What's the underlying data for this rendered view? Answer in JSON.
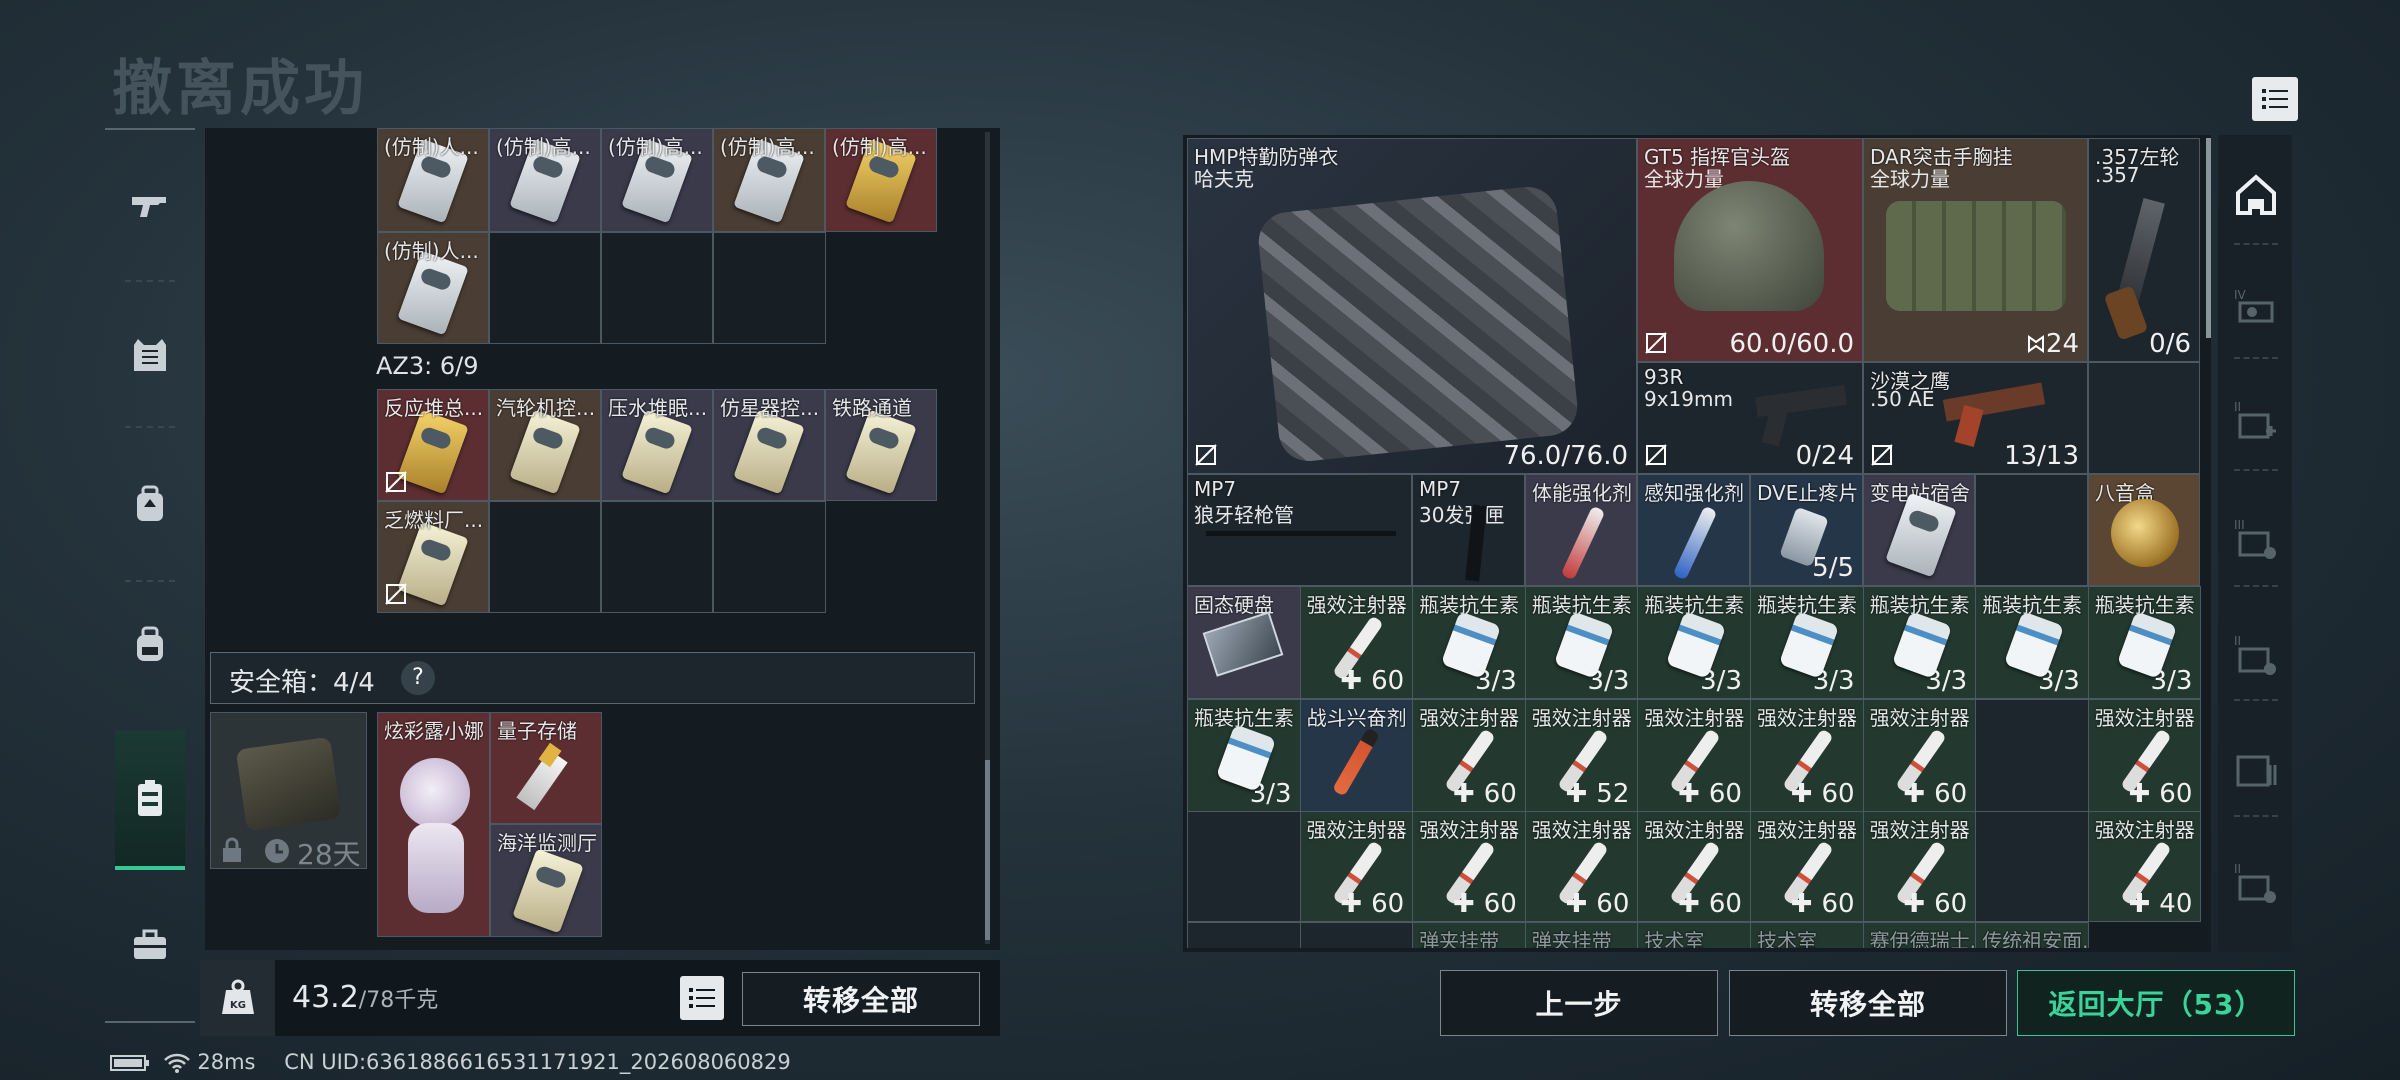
{
  "page": {
    "title": "撤离成功"
  },
  "sidebar": {
    "items": [
      {
        "icon": "pistol-icon"
      },
      {
        "icon": "vest-icon"
      },
      {
        "icon": "backpack-armor-icon"
      },
      {
        "icon": "backpack-icon"
      },
      {
        "icon": "safe-case-icon",
        "active": true
      },
      {
        "icon": "briefcase-icon"
      }
    ]
  },
  "left": {
    "top_row": [
      "(仿制)人...",
      "(仿制)高...",
      "(仿制)高...",
      "(仿制)高...",
      "(仿制)高..."
    ],
    "top_row2": [
      "(仿制)人..."
    ],
    "az3_label": "AZ3: 6/9",
    "az3_row1": [
      "反应堆总...",
      "汽轮机控...",
      "压水堆眠...",
      "仿星器控...",
      "铁路通道"
    ],
    "az3_row2": [
      "乏燃料厂..."
    ],
    "safebox_label": "安全箱：4/4",
    "help": "?",
    "safebox_timer": "28天",
    "safe_items": {
      "doll": "炫彩露小娜",
      "usb": "量子存储",
      "card": "海洋监测厅"
    },
    "weight_value": "43.2",
    "weight_max": "/78千克",
    "transfer_all": "转移全部"
  },
  "status": {
    "ping": "28ms",
    "uid": "CN UID:6361886616531171921_202608060829"
  },
  "right": {
    "vest": {
      "name": "HMP特勤防弹衣",
      "sub": "哈夫克",
      "dur": "76.0/76.0"
    },
    "helmet": {
      "name": "GT5 指挥官头盔",
      "sub": "全球力量",
      "dur": "60.0/60.0"
    },
    "rig": {
      "name": "DAR突击手胸挂",
      "sub": "全球力量",
      "cap": "24"
    },
    "revolver": {
      "name": ".357左轮",
      "sub": ".357",
      "ammo": "0/6"
    },
    "pistol1": {
      "name": "93R",
      "sub": "9x19mm",
      "ammo": "0/24"
    },
    "pistol2": {
      "name": "沙漠之鹰",
      "sub": ".50 AE",
      "ammo": "13/13"
    },
    "row3": [
      {
        "name": "MP7",
        "sub": "狼牙轻枪管"
      },
      {
        "name": "MP7",
        "sub": "30发弹匣"
      },
      {
        "name": "体能强化剂"
      },
      {
        "name": "感知强化剂"
      },
      {
        "name": "DVE止疼片",
        "val": "5/5"
      },
      {
        "name": "变电站宿舍"
      },
      {
        "name": "八音盒"
      }
    ],
    "row4": [
      {
        "name": "固态硬盘",
        "val": ""
      },
      {
        "name": "强效注射器",
        "val": "60"
      },
      {
        "name": "瓶装抗生素",
        "val": "3/3"
      },
      {
        "name": "瓶装抗生素",
        "val": "3/3"
      },
      {
        "name": "瓶装抗生素",
        "val": "3/3"
      },
      {
        "name": "瓶装抗生素",
        "val": "3/3"
      },
      {
        "name": "瓶装抗生素",
        "val": "3/3"
      },
      {
        "name": "瓶装抗生素",
        "val": "3/3"
      },
      {
        "name": "瓶装抗生素",
        "val": "3/3"
      }
    ],
    "row5": [
      {
        "name": "瓶装抗生素",
        "val": "3/3"
      },
      {
        "name": "战斗兴奋剂",
        "val": ""
      },
      {
        "name": "强效注射器",
        "val": "60"
      },
      {
        "name": "强效注射器",
        "val": "52"
      },
      {
        "name": "强效注射器",
        "val": "60"
      },
      {
        "name": "强效注射器",
        "val": "60"
      },
      {
        "name": "强效注射器",
        "val": "60"
      },
      {
        "name": "",
        "val": ""
      },
      {
        "name": "强效注射器",
        "val": "60"
      }
    ],
    "row6": [
      {
        "name": "",
        "val": ""
      },
      {
        "name": "强效注射器",
        "val": "60"
      },
      {
        "name": "强效注射器",
        "val": "60"
      },
      {
        "name": "强效注射器",
        "val": "60"
      },
      {
        "name": "强效注射器",
        "val": "60"
      },
      {
        "name": "强效注射器",
        "val": "60"
      },
      {
        "name": "强效注射器",
        "val": "60"
      },
      {
        "name": "",
        "val": ""
      },
      {
        "name": "强效注射器",
        "val": "40"
      }
    ],
    "row7_partial": [
      "",
      "",
      "弹夹挂带",
      "弹夹挂带",
      "技术室",
      "技术室",
      "赛伊德瑞士...",
      "传统祖安面..."
    ]
  },
  "bottom": {
    "back": "上一步",
    "transfer_all": "转移全部",
    "return_lobby": "返回大厅（53）"
  },
  "colors": {
    "accent_green": "#39c693",
    "return_text": "#3ad49b"
  }
}
